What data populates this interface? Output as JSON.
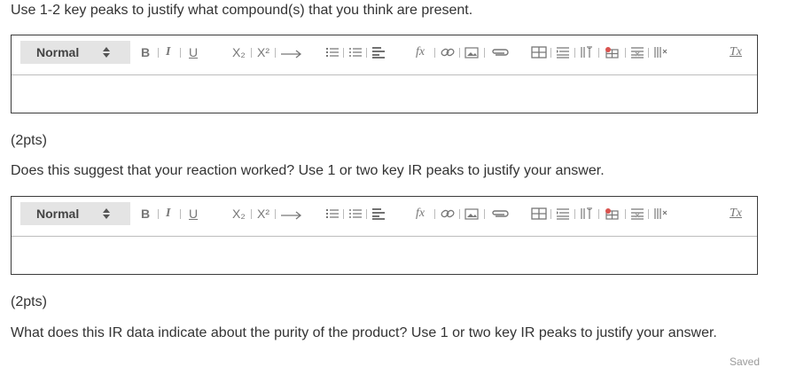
{
  "questions": [
    {
      "prompt": "Use 1-2 key peaks to justify what compound(s) that you think are present.",
      "points": ""
    },
    {
      "points": "(2pts)",
      "prompt": "Does this suggest that your reaction worked? Use 1 or two key IR peaks to justify your answer."
    },
    {
      "points": "(2pts)",
      "prompt": "What does this IR data indicate about the purity of the product? Use 1 or two key IR peaks to justify your answer."
    }
  ],
  "editor": {
    "format_value": "Normal",
    "toolbar": {
      "bold": "B",
      "italic": "I",
      "underline": "U",
      "subscript": "X₂",
      "superscript": "X²",
      "formula": "fx",
      "clear": "Tx"
    },
    "icons": [
      "sort-arrows-icon",
      "bold-icon",
      "italic-icon",
      "underline-icon",
      "subscript-icon",
      "superscript-icon",
      "arrow-right-icon",
      "numbered-list-icon",
      "bulleted-list-icon",
      "align-icon",
      "formula-icon",
      "link-icon",
      "image-icon",
      "attachment-icon",
      "table-icon",
      "insert-row-icon",
      "insert-column-icon",
      "delete-table-icon",
      "delete-row-icon",
      "delete-column-icon",
      "clear-format-icon"
    ]
  },
  "status": {
    "saved": "Saved"
  },
  "colors": {
    "text": "#333333",
    "toolbar_icon": "#777777",
    "select_bg": "#e4e4e4",
    "border": "#3b3b3b",
    "saved": "#9a9a9a",
    "accent_red": "#d9534f"
  }
}
